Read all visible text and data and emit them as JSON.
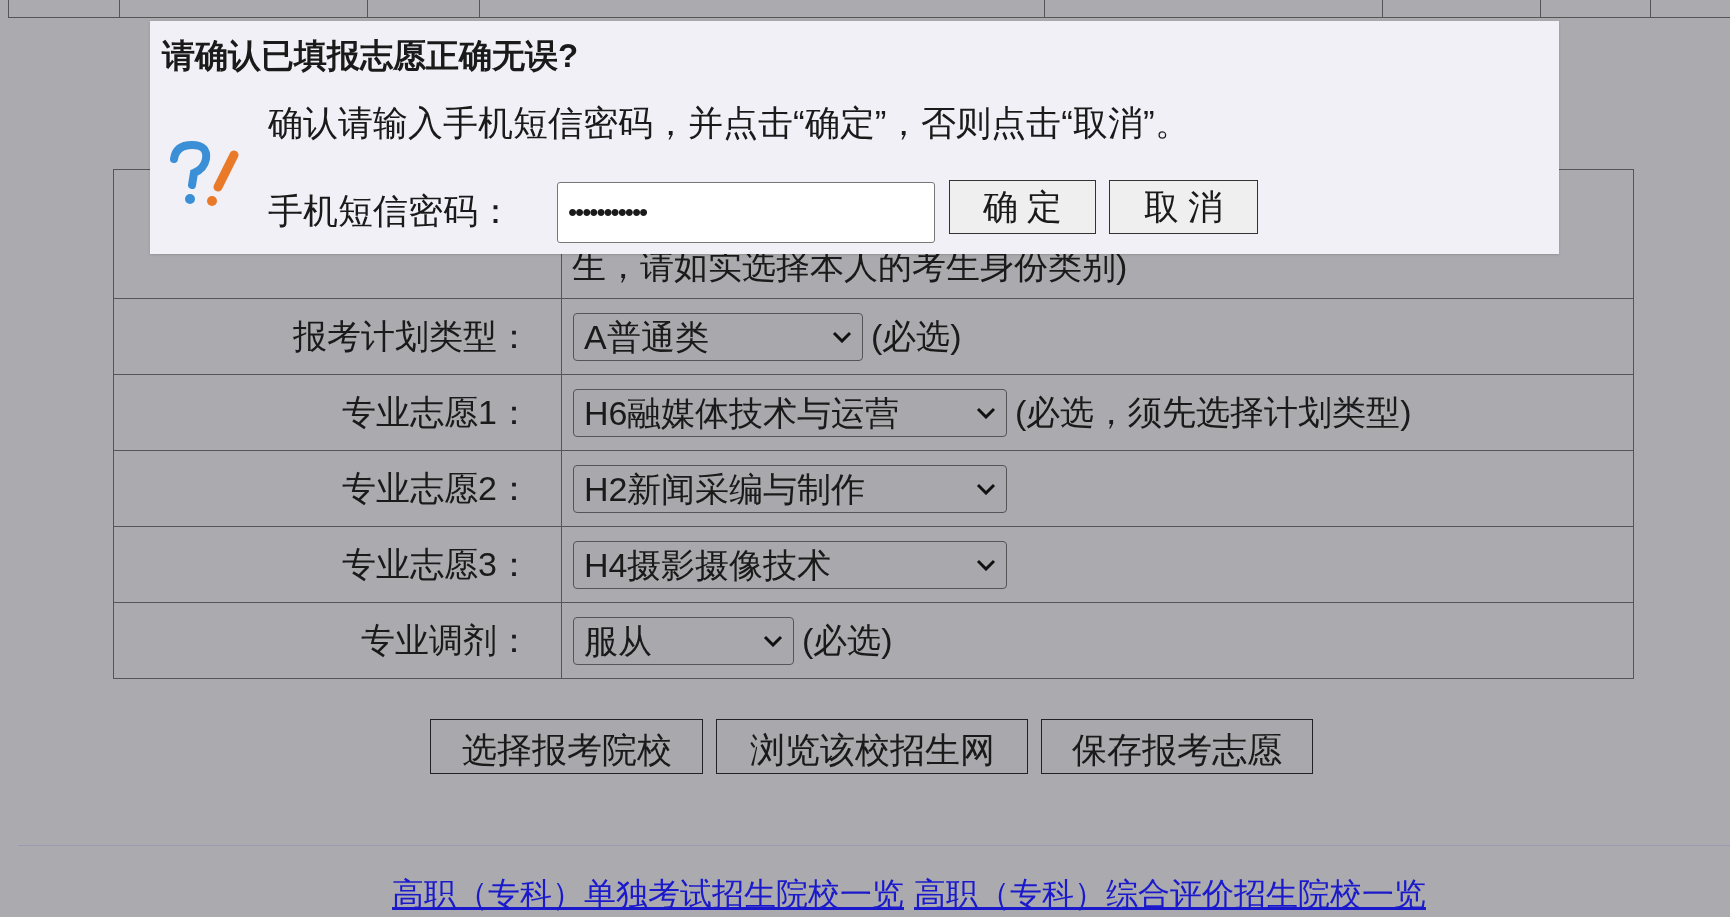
{
  "dialog": {
    "title": "请确认已填报志愿正确无误?",
    "message": "确认请输入手机短信密码，并点击“确定”，否则点击“取消”。",
    "field_label": "手机短信密码：",
    "password_value": "•••••••••••",
    "buttons": [
      "确 定",
      "取 消"
    ]
  },
  "form": {
    "first_row_text": "生，请如实选择本人的考生身份类别)",
    "rows": [
      {
        "label": "报考计划类型：",
        "value": "A普通类",
        "hint": "(必选)"
      },
      {
        "label": "专业志愿1：",
        "value": "H6融媒体技术与运营",
        "hint": "(必选，须先选择计划类型)"
      },
      {
        "label": "专业志愿2：",
        "value": "H2新闻采编与制作"
      },
      {
        "label": "专业志愿3：",
        "value": "H4摄影摄像技术"
      },
      {
        "label": "专业调剂：",
        "value": "服从",
        "hint": "(必选)"
      }
    ]
  },
  "actions": [
    "选择报考院校",
    "浏览该校招生网",
    "保存报考志愿"
  ],
  "links": [
    "高职（专科）单独考试招生院校一览",
    "高职（专科）综合评价招生院校一览"
  ]
}
